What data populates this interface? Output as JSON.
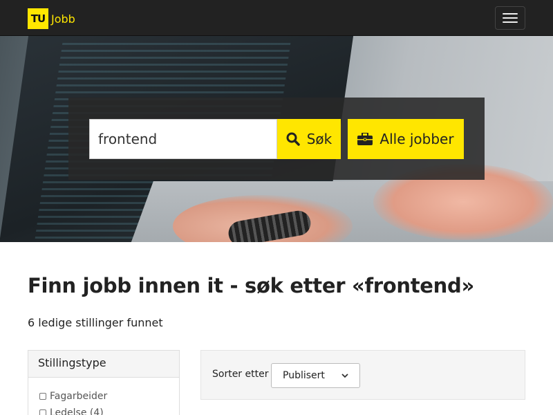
{
  "navbar": {
    "logo_text": "TU",
    "brand_text": "Jobb",
    "menu_icon": "hamburger-menu-icon",
    "accent_color": "#ffe600",
    "background_color": "#222222"
  },
  "hero": {
    "search": {
      "value": "frontend",
      "placeholder": ""
    },
    "search_button": {
      "label": "Søk",
      "icon": "search-icon"
    },
    "all_jobs_button": {
      "label": "Alle jobber",
      "icon": "briefcase-icon"
    }
  },
  "main": {
    "title": "Finn jobb innen it - søk etter «frontend»",
    "result_count": "6 ledige stillinger funnet"
  },
  "filters": {
    "title": "Stillingstype",
    "options": [
      {
        "label": "Fagarbeider",
        "checked": false
      },
      {
        "label": "Ledelse (4)",
        "checked": false
      }
    ]
  },
  "sort": {
    "label": "Sorter etter",
    "selected": "Publisert"
  }
}
